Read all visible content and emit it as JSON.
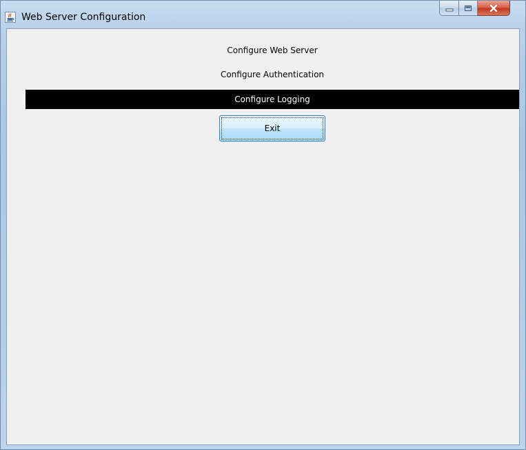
{
  "window": {
    "title": "Web Server Configuration",
    "controls": {
      "minimize_icon": "minimize-icon",
      "maximize_icon": "maximize-icon",
      "close_icon": "close-icon"
    }
  },
  "menu": {
    "items": [
      {
        "label": "Configure Web Server",
        "selected": false
      },
      {
        "label": "Configure Authentication",
        "selected": false
      },
      {
        "label": "Configure Logging",
        "selected": true
      }
    ],
    "exit_label": "Exit"
  },
  "colors": {
    "selected_background": "#000000",
    "selected_text": "#ffffff",
    "panel_background": "#f0f0f0",
    "close_button": "#c7452c"
  }
}
